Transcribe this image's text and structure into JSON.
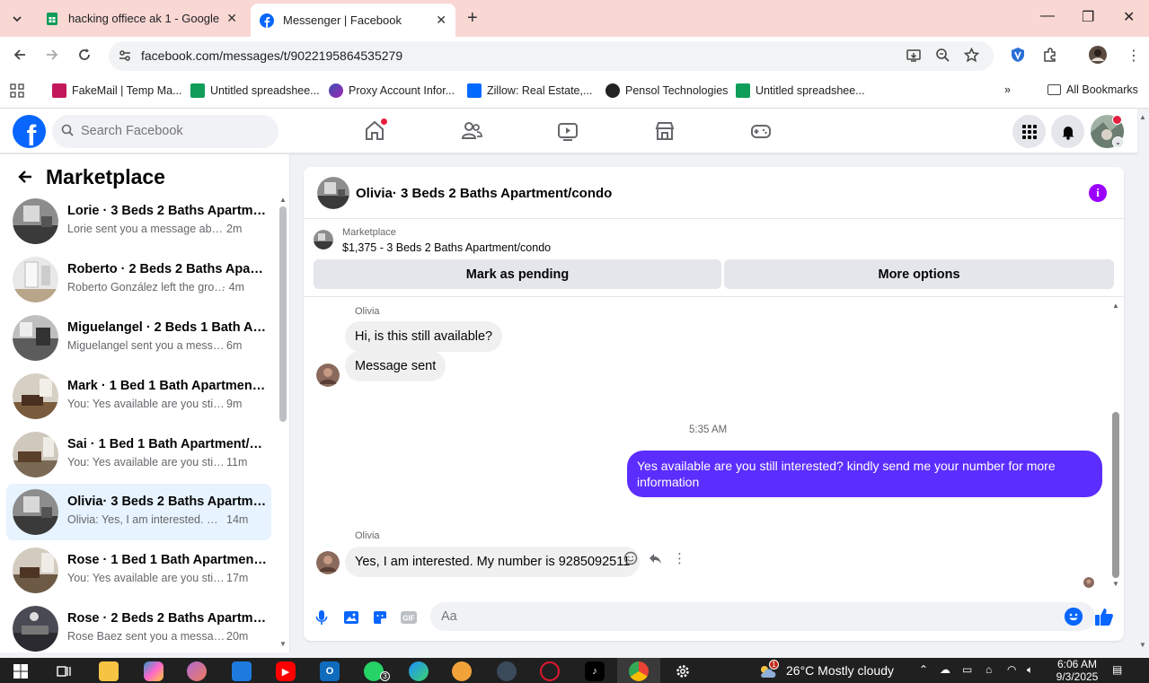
{
  "browser": {
    "tabs": [
      {
        "title": "hacking offiece ak 1 - Google Sh",
        "icon": "google-sheets-icon"
      },
      {
        "title": "Messenger | Facebook",
        "icon": "facebook-icon"
      }
    ],
    "url": "facebook.com/messages/t/9022195864535279",
    "bookmarks": [
      {
        "label": "FakeMail | Temp Ma..."
      },
      {
        "label": "Untitled spreadshee..."
      },
      {
        "label": "Proxy Account Infor..."
      },
      {
        "label": "Zillow: Real Estate,..."
      },
      {
        "label": "Pensol Technologies"
      },
      {
        "label": "Untitled spreadshee..."
      }
    ],
    "all_bookmarks": "All Bookmarks"
  },
  "facebook": {
    "logo": "f",
    "search_placeholder": "Search Facebook"
  },
  "sidebar": {
    "title": "Marketplace",
    "conversations": [
      {
        "name": "Lorie · 3 Beds 2 Baths Apartmen...",
        "preview": "Lorie sent you a message about yo...",
        "time": "2m"
      },
      {
        "name": "Roberto · 2 Beds 2 Baths Apart...",
        "preview": "Roberto González left the group.",
        "time": "· 4m"
      },
      {
        "name": "Miguelangel · 2 Beds 1 Bath Apa...",
        "preview": "Miguelangel sent you a message a...",
        "time": "6m"
      },
      {
        "name": "Mark · 1 Bed 1 Bath Apartment/...",
        "preview": "You: Yes available are you still inter...",
        "time": "9m"
      },
      {
        "name": "Sai · 1 Bed 1 Bath Apartment/co...",
        "preview": "You: Yes available are you still int...",
        "time": "11m"
      },
      {
        "name": "Olivia· 3 Beds 2 Baths Apartmen...",
        "preview": "Olivia: Yes, I am interested. My n...",
        "time": "14m"
      },
      {
        "name": "Rose · 1 Bed 1 Bath Apartment/c...",
        "preview": "You: Yes available are you still int...",
        "time": "17m"
      },
      {
        "name": "Rose · 2 Beds 2 Baths Apartmen...",
        "preview": "Rose Baez sent you a message a...",
        "time": "20m"
      }
    ]
  },
  "chat": {
    "title": "Olivia· 3 Beds 2 Baths Apartment/condo",
    "marketplace_label": "Marketplace",
    "listing": "$1,375 - 3 Beds 2 Baths Apartment/condo",
    "mark_pending": "Mark as pending",
    "more_options": "More options",
    "messages": {
      "sender1": "Olivia",
      "msg1": "Hi, is this still available?",
      "msg2": "Message sent",
      "timestamp": "5:35 AM",
      "out1": "Yes available are you still interested? kindly send me your number for more information",
      "sender2": "Olivia",
      "msg3": "Yes, I am interested. My number is 9285092511"
    },
    "composer_placeholder": "Aa"
  },
  "taskbar": {
    "whatsapp_badge": "3",
    "weather_badge": "1",
    "weather": "26°C  Mostly cloudy",
    "time": "6:06 AM",
    "date": "9/3/2025"
  }
}
